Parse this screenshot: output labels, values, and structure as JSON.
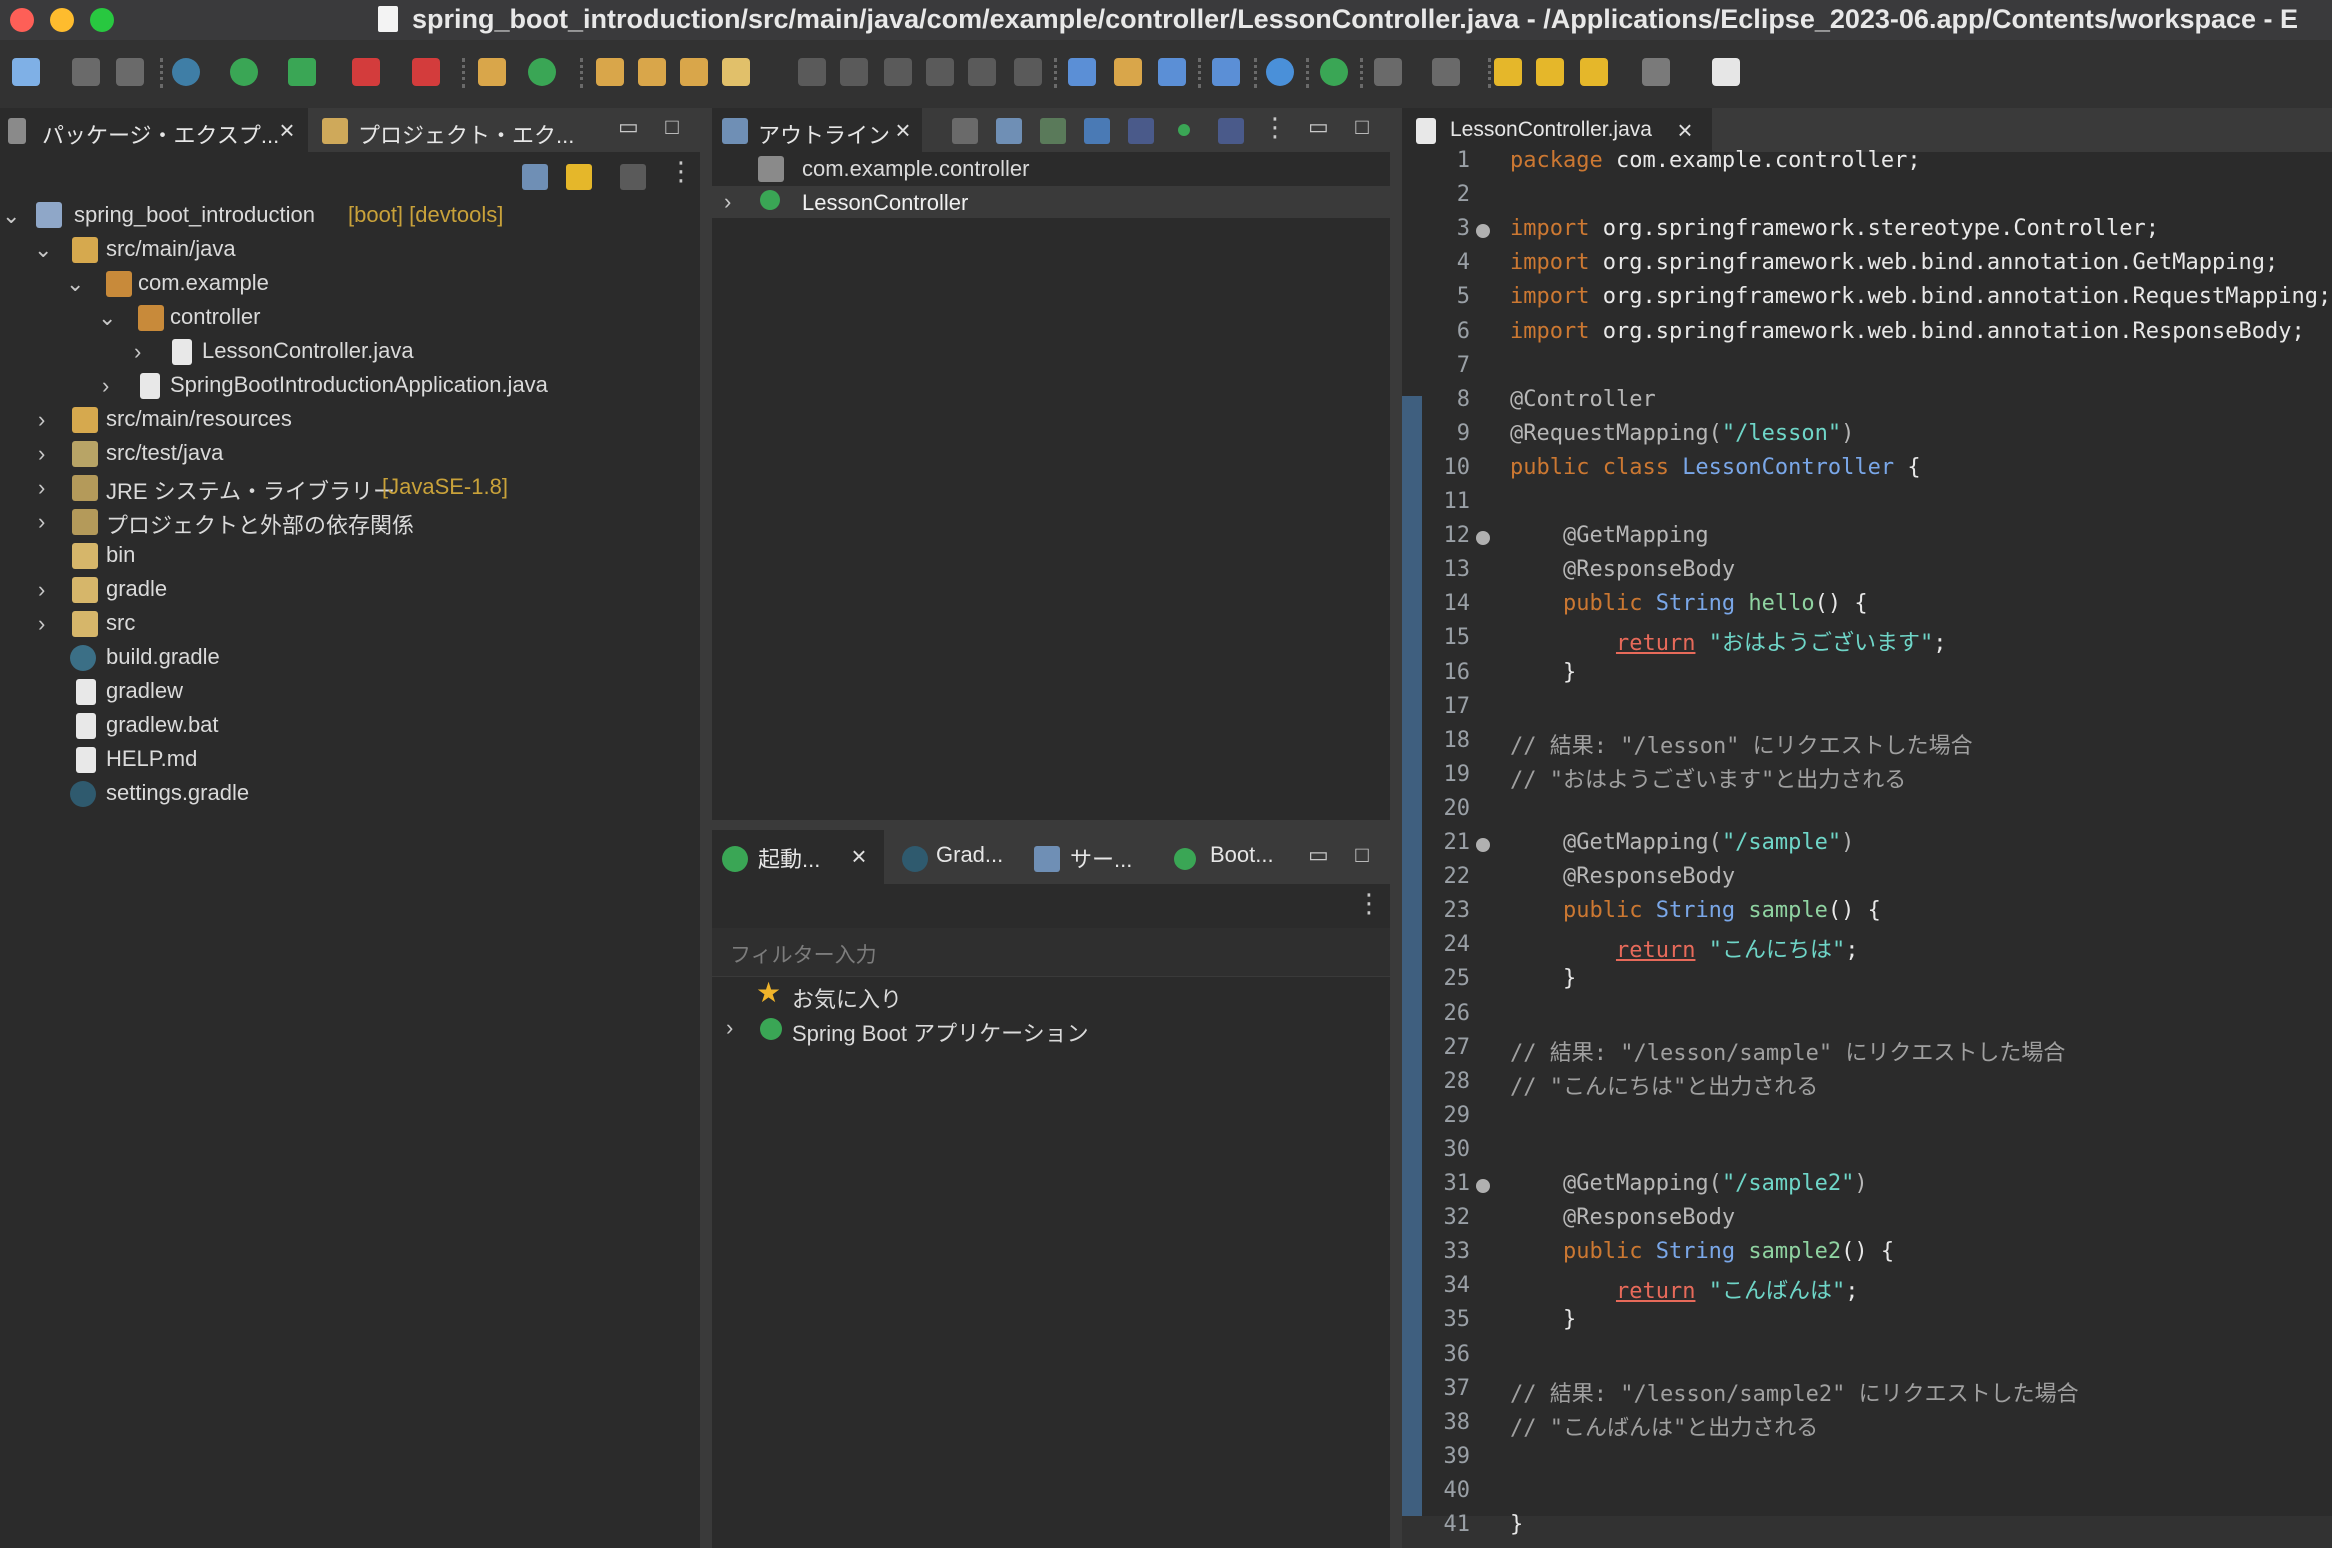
{
  "window": {
    "title": "spring_boot_introduction/src/main/java/com/example/controller/LessonController.java - /Applications/Eclipse_2023-06.app/Contents/workspace - E"
  },
  "colors": {
    "accent": "#4a90d9",
    "red": "#fe5f57",
    "yellow": "#febc2e",
    "green": "#28c840",
    "string": "#6fd6c8",
    "keyword": "#cc7832"
  },
  "explorer": {
    "tab_packages": "パッケージ・エクスプ...",
    "tab_project": "プロジェクト・エク...",
    "tree": [
      {
        "label": "spring_boot_introduction",
        "suffix": "[boot] [devtools]",
        "icon": "project-icon"
      },
      {
        "label": "src/main/java",
        "icon": "source-folder-icon"
      },
      {
        "label": "com.example",
        "icon": "package-icon"
      },
      {
        "label": "controller",
        "icon": "package-icon"
      },
      {
        "label": "LessonController.java",
        "icon": "java-file-icon"
      },
      {
        "label": "SpringBootIntroductionApplication.java",
        "icon": "java-file-icon"
      },
      {
        "label": "src/main/resources",
        "icon": "source-folder-icon"
      },
      {
        "label": "src/test/java",
        "icon": "source-folder-icon"
      },
      {
        "label": "JRE システム・ライブラリー",
        "suffix": "[JavaSE-1.8]",
        "icon": "library-icon"
      },
      {
        "label": "プロジェクトと外部の依存関係",
        "icon": "library-icon"
      },
      {
        "label": "bin",
        "icon": "folder-icon"
      },
      {
        "label": "gradle",
        "icon": "folder-icon"
      },
      {
        "label": "src",
        "icon": "folder-icon"
      },
      {
        "label": "build.gradle",
        "icon": "gradle-file-icon"
      },
      {
        "label": "gradlew",
        "icon": "text-file-icon"
      },
      {
        "label": "gradlew.bat",
        "icon": "text-file-icon"
      },
      {
        "label": "HELP.md",
        "icon": "markdown-file-icon"
      },
      {
        "label": "settings.gradle",
        "icon": "gradle-file-icon"
      }
    ]
  },
  "outline": {
    "tab_label": "アウトライン",
    "items": [
      {
        "label": "com.example.controller",
        "icon": "package-icon"
      },
      {
        "label": "LessonController",
        "icon": "class-icon"
      }
    ]
  },
  "launch": {
    "tabs": [
      "起動...",
      "Grad...",
      "サー...",
      "Boot..."
    ],
    "filter_placeholder": "フィルター入力",
    "items": [
      {
        "label": "お気に入り",
        "icon": "star-icon"
      },
      {
        "label": "Spring Boot アプリケーション",
        "icon": "spring-boot-icon"
      }
    ]
  },
  "editor": {
    "tab_label": "LessonController.java",
    "line_numbers": [
      "1",
      "2",
      "3",
      "4",
      "5",
      "6",
      "7",
      "8",
      "9",
      "10",
      "11",
      "12",
      "13",
      "14",
      "15",
      "16",
      "17",
      "18",
      "19",
      "20",
      "21",
      "22",
      "23",
      "24",
      "25",
      "26",
      "27",
      "28",
      "29",
      "30",
      "31",
      "32",
      "33",
      "34",
      "35",
      "36",
      "37",
      "38",
      "39",
      "40",
      "41"
    ],
    "code": {
      "l1_kw": "package",
      "l1_rest": " com.example.controller;",
      "l3_kw": "import",
      "l3_rest": " org.springframework.stereotype.Controller;",
      "l4_kw": "import",
      "l4_rest": " org.springframework.web.bind.annotation.GetMapping;",
      "l5_kw": "import",
      "l5_rest": " org.springframework.web.bind.annotation.RequestMapping;",
      "l6_kw": "import",
      "l6_rest": " org.springframework.web.bind.annotation.ResponseBody;",
      "l8": "@Controller",
      "l9_ann": "@RequestMapping(",
      "l9_str": "\"/lesson\"",
      "l9_end": ")",
      "l10_kw": "public class ",
      "l10_cls": "LessonController",
      "l10_end": " {",
      "l12": "@GetMapping",
      "l13": "@ResponseBody",
      "l14_kw": "public ",
      "l14_type": "String ",
      "l14_fn": "hello",
      "l14_end": "() {",
      "l15_ret": "return",
      "l15_str": " \"おはようございます\"",
      "l15_end": ";",
      "l16": "}",
      "l18": "// 結果: \"/lesson\" にリクエストした場合",
      "l19": "// \"おはようございます\"と出力される",
      "l21_ann": "@GetMapping(",
      "l21_str": "\"/sample\"",
      "l21_end": ")",
      "l22": "@ResponseBody",
      "l23_kw": "public ",
      "l23_type": "String ",
      "l23_fn": "sample",
      "l23_end": "() {",
      "l24_ret": "return",
      "l24_str": " \"こんにちは\"",
      "l24_end": ";",
      "l25": "}",
      "l27": "// 結果: \"/lesson/sample\" にリクエストした場合",
      "l28": "// \"こんにちは\"と出力される",
      "l31_ann": "@GetMapping(",
      "l31_str": "\"/sample2\"",
      "l31_end": ")",
      "l32": "@ResponseBody",
      "l33_kw": "public ",
      "l33_type": "String ",
      "l33_fn": "sample2",
      "l33_end": "() {",
      "l34_ret": "return",
      "l34_str": " \"こんばんは\"",
      "l34_end": ";",
      "l35": "}",
      "l37": "// 結果: \"/lesson/sample2\" にリクエストした場合",
      "l38": "// \"こんばんは\"と出力される",
      "l41": "}"
    }
  }
}
